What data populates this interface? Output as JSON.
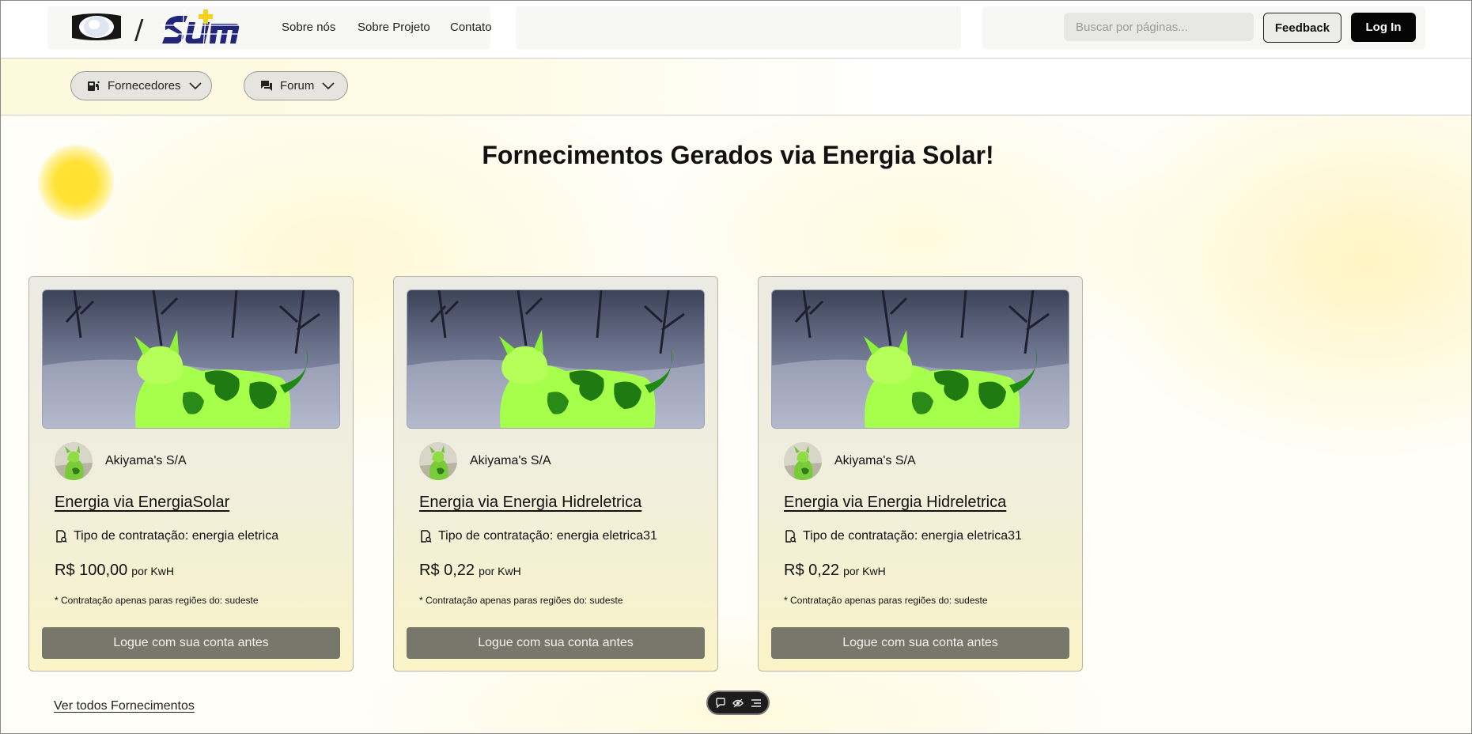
{
  "header": {
    "nav": [
      "Sobre nós",
      "Sobre Projeto",
      "Contato"
    ],
    "search_placeholder": "Buscar por páginas...",
    "feedback_label": "Feedback",
    "login_label": "Log In"
  },
  "subnav": {
    "fornecedores_label": "Fornecedores",
    "forum_label": "Forum"
  },
  "main": {
    "title": "Fornecimentos Gerados via Energia Solar!",
    "see_all_label": "Ver todos Fornecimentos"
  },
  "cards": [
    {
      "provider": "Akiyama's S/A",
      "title": "Energia via EnergiaSolar",
      "contract": "Tipo de contratação: energia eletrica",
      "price": "R$ 100,00",
      "unit": "por KwH",
      "note": "* Contratação apenas paras regiões do: sudeste",
      "button": "Logue com sua conta antes"
    },
    {
      "provider": "Akiyama's S/A",
      "title": "Energia via Energia Hidreletrica",
      "contract": "Tipo de contratação: energia eletrica31",
      "price": "R$ 0,22",
      "unit": "por KwH",
      "note": "* Contratação apenas paras regiões do: sudeste",
      "button": "Logue com sua conta antes"
    },
    {
      "provider": "Akiyama's S/A",
      "title": "Energia via Energia Hidreletrica",
      "contract": "Tipo de contratação: energia eletrica31",
      "price": "R$ 0,22",
      "unit": "por KwH",
      "note": "* Contratação apenas paras regiões do: sudeste",
      "button": "Logue com sua conta antes"
    }
  ],
  "icons": {
    "fornecedores": "supplier-icon",
    "forum": "forum-icon",
    "contract": "document-icon",
    "toolbar": [
      "comment-icon",
      "eye-icon",
      "list-icon"
    ]
  },
  "colors": {
    "accent_yellow": "#ffe033",
    "logo_blue": "#22267a",
    "login_bg": "#050505",
    "card_button_bg": "#77776b"
  }
}
